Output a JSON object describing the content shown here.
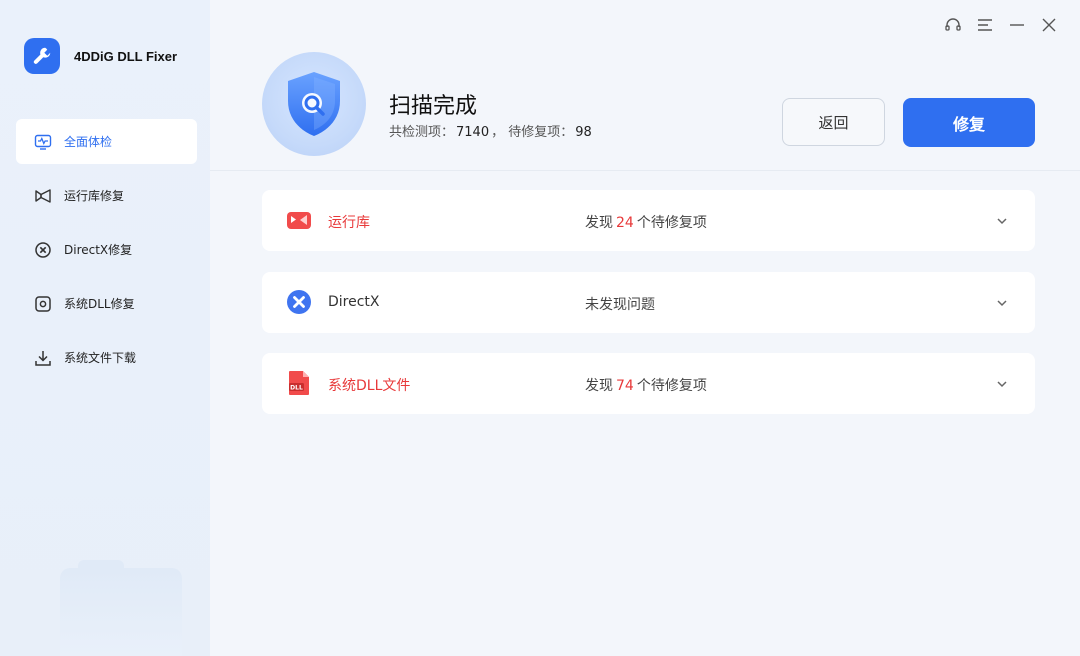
{
  "app": {
    "name": "4DDiG DLL Fixer"
  },
  "sidebar": {
    "items": [
      {
        "label": "全面体检",
        "icon": "pulse-monitor-icon",
        "active": true
      },
      {
        "label": "运行库修复",
        "icon": "runtime-library-icon",
        "active": false
      },
      {
        "label": "DirectX修复",
        "icon": "directx-icon",
        "active": false
      },
      {
        "label": "系统DLL修复",
        "icon": "system-dll-icon",
        "active": false
      },
      {
        "label": "系统文件下载",
        "icon": "download-icon",
        "active": false
      }
    ]
  },
  "window_controls": [
    "headset-icon",
    "menu-icon",
    "minimize-icon",
    "close-icon"
  ],
  "header": {
    "title": "扫描完成",
    "summary_prefix": "共检测项：",
    "total_checked": "7140",
    "summary_mid": "，  待修复项：",
    "pending": "98",
    "back_label": "返回",
    "repair_label": "修复"
  },
  "results": [
    {
      "name": "运行库",
      "icon": "runtime-library-icon",
      "status_prefix": "发现",
      "count": "24",
      "status_suffix": "个待修复项",
      "has_issues": true
    },
    {
      "name": "DirectX",
      "icon": "directx-icon",
      "status_text": "未发现问题",
      "has_issues": false
    },
    {
      "name": "系统DLL文件",
      "icon": "system-dll-file-icon",
      "status_prefix": "发现",
      "count": "74",
      "status_suffix": "个待修复项",
      "has_issues": true
    }
  ],
  "colors": {
    "accent": "#2f6ff0",
    "error": "#e8393a",
    "sidebar_bg": "#eaf1fb",
    "main_bg": "#f3f6fb"
  }
}
